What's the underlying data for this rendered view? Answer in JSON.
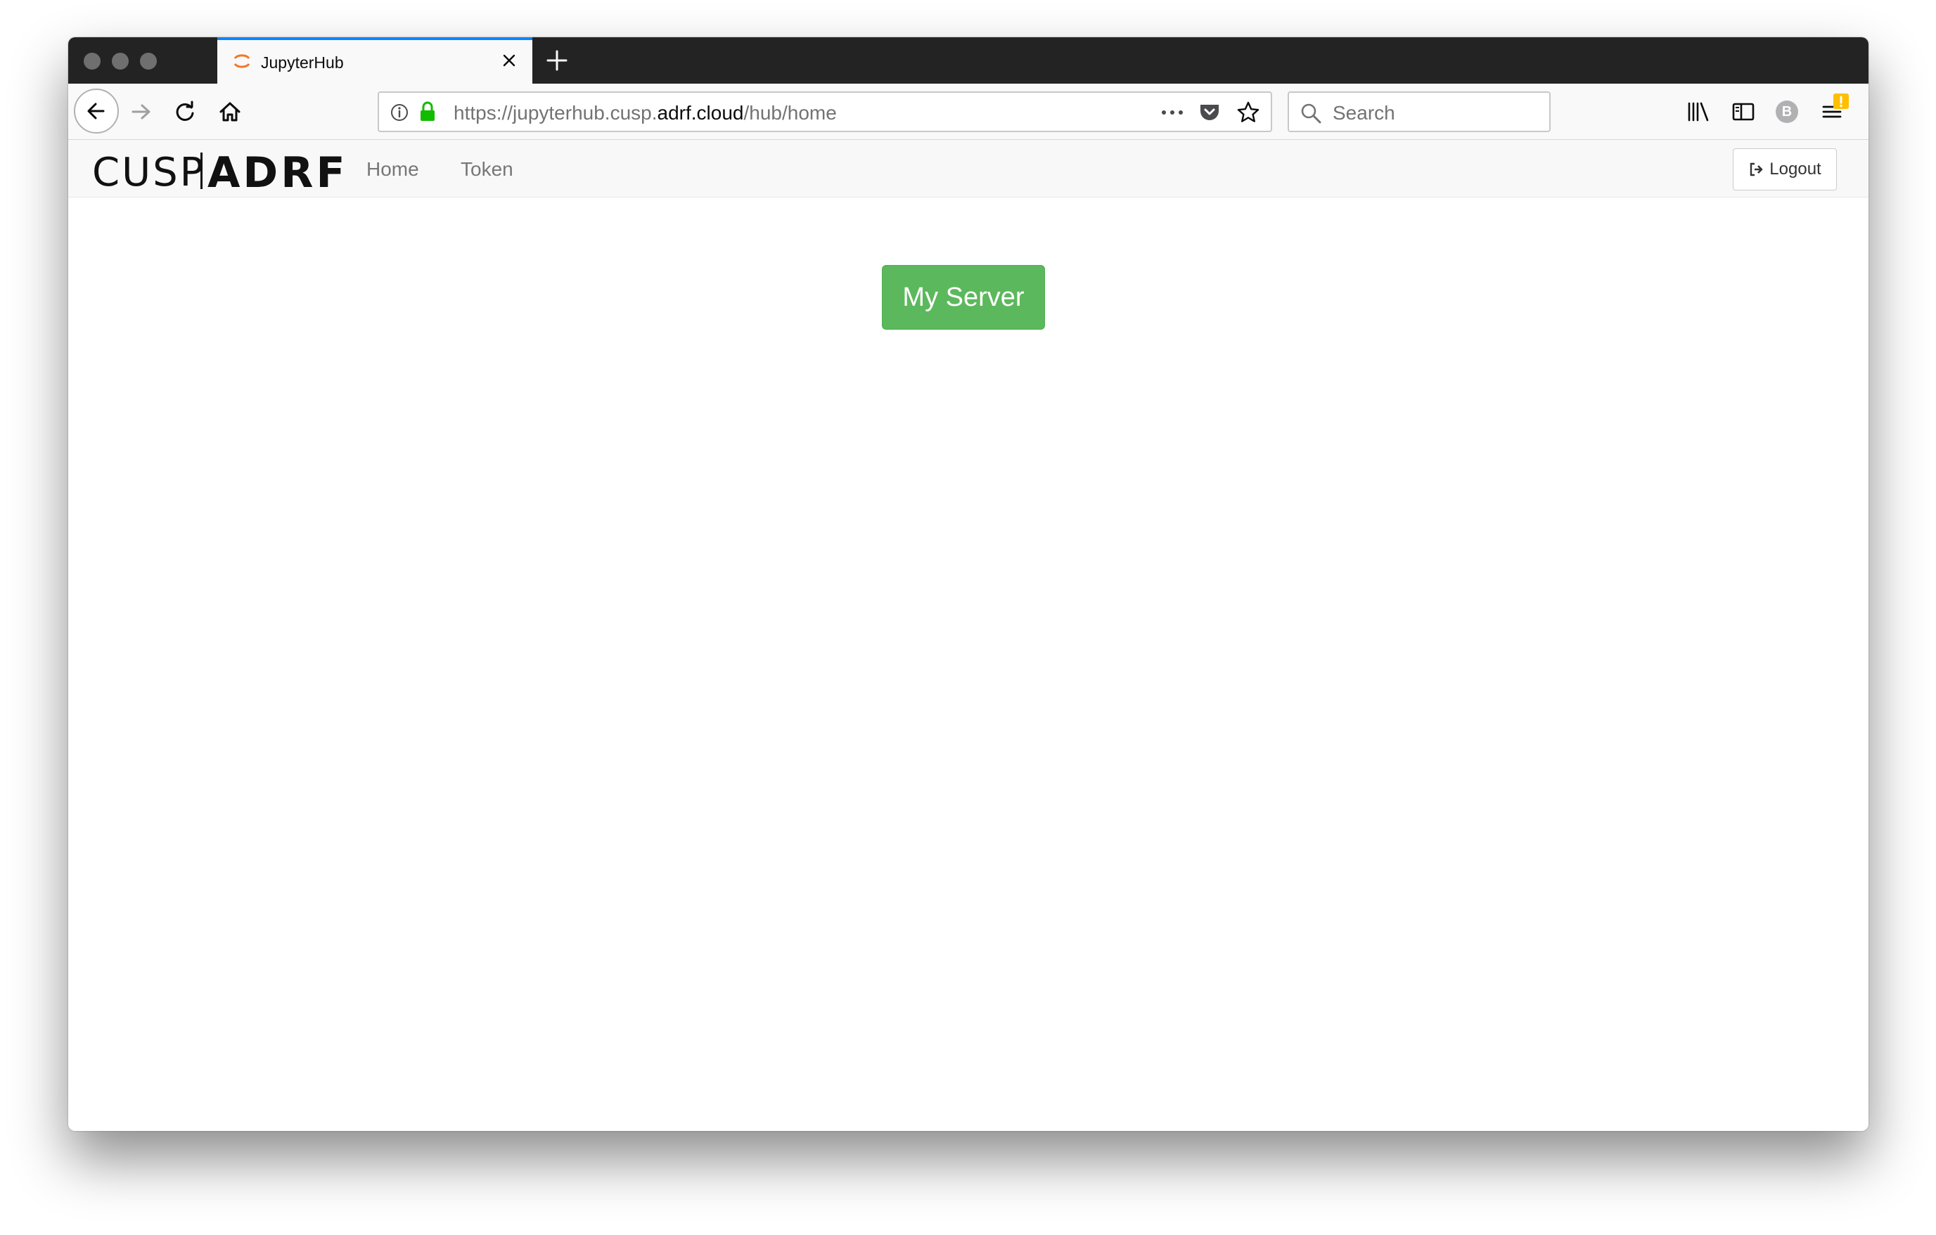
{
  "browser": {
    "tab": {
      "title": "JupyterHub"
    },
    "url": {
      "prefix": "https://jupyterhub.cusp.",
      "host": "adrf.cloud",
      "path": "/hub/home"
    },
    "search": {
      "placeholder": "Search"
    },
    "profile_initial": "B",
    "accent_color": "#0a84ff",
    "secure_lock_color": "#12bc00",
    "warning_badge_color": "#ffbf00"
  },
  "site": {
    "logo": {
      "left": "CUSP",
      "right": "ADRF"
    },
    "nav": [
      {
        "label": "Home"
      },
      {
        "label": "Token"
      }
    ],
    "logout_label": "Logout",
    "primary_action": {
      "label": "My Server",
      "color": "#5cb85c"
    }
  }
}
